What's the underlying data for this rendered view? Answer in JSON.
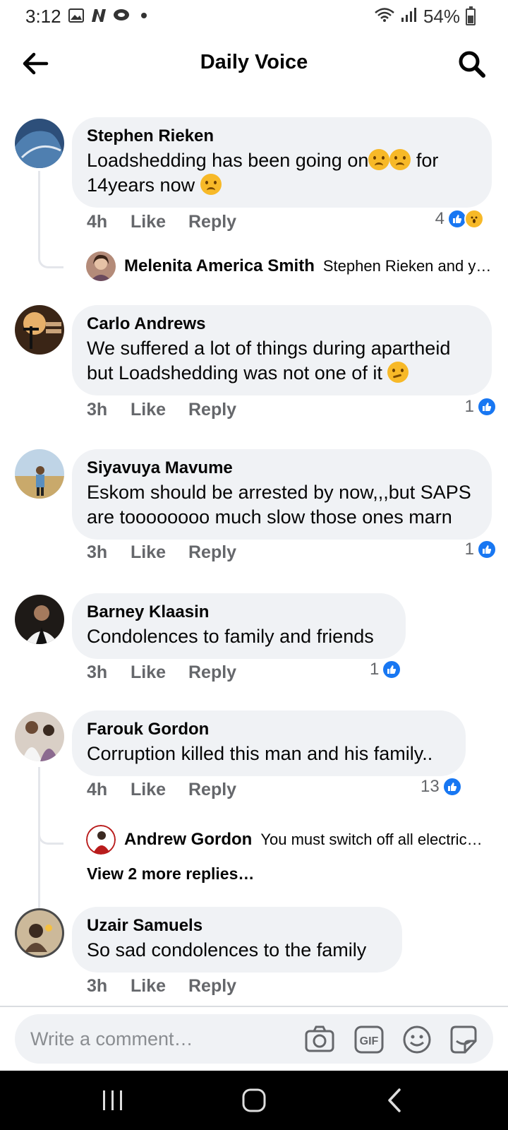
{
  "status_bar": {
    "time": "3:12",
    "battery": "54%",
    "battery_level": 0.54
  },
  "header": {
    "title": "Daily Voice"
  },
  "comments": [
    {
      "name": "Stephen Rieken",
      "text": "Loadshedding has been going on",
      "text2": " for",
      "text3": "14years now ",
      "time": "4h",
      "like": "Like",
      "reply": "Reply",
      "reaction_count": "4",
      "reply_preview": {
        "name": "Melenita America Smith",
        "text": "Stephen Rieken and y…"
      }
    },
    {
      "name": "Carlo Andrews",
      "text": "We suffered a lot of things during apartheid but Loadshedding was not one of it ",
      "time": "3h",
      "like": "Like",
      "reply": "Reply",
      "reaction_count": "1"
    },
    {
      "name": "Siyavuya Mavume",
      "text": "Eskom should be arrested by now,,,but SAPS are toooooooo much slow those ones marn",
      "time": "3h",
      "like": "Like",
      "reply": "Reply",
      "reaction_count": "1"
    },
    {
      "name": "Barney Klaasin",
      "text": "Condolences to family and friends",
      "time": "3h",
      "like": "Like",
      "reply": "Reply",
      "reaction_count": "1"
    },
    {
      "name": "Farouk Gordon",
      "text": "Corruption killed this man and his family..",
      "time": "4h",
      "like": "Like",
      "reply": "Reply",
      "reaction_count": "13",
      "reply_preview": {
        "name": "Andrew Gordon",
        "text": "You must switch off all electric…"
      },
      "view_more": "View 2 more replies…"
    },
    {
      "name": "Uzair Samuels",
      "text": "So sad condolences to the family",
      "time": "3h",
      "like": "Like",
      "reply": "Reply"
    }
  ],
  "composer": {
    "placeholder": "Write a comment…",
    "icons": [
      "camera-icon",
      "gif-icon",
      "emoji-icon",
      "sticker-icon"
    ]
  },
  "colors": {
    "accent": "#1877f2",
    "bubble": "#f0f2f5",
    "meta_text": "#65676b"
  }
}
